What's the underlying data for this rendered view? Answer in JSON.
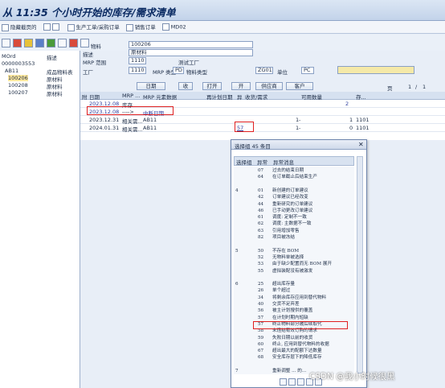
{
  "title": "从 11:35 个小时开始的库存/需求清单",
  "toolbar1": {
    "items": [
      "隐藏截页的",
      "",
      "生产工单/采购订单",
      "销售订单",
      "MD02"
    ]
  },
  "left": {
    "header": [
      "MRP",
      "描述"
    ],
    "hdr0": "MOrd",
    "rows": [
      {
        "code": "0000003553",
        "desc": ""
      },
      {
        "code": "AB11",
        "desc": "成品物料表"
      },
      {
        "code": "100206",
        "desc": "原材料"
      },
      {
        "code": "100208",
        "desc": "原材料"
      },
      {
        "code": "100207",
        "desc": "原材料"
      }
    ]
  },
  "header": {
    "material_lbl": "物料",
    "material_val": "100206",
    "desc_lbl": "描述",
    "desc_val": "原材料",
    "mrp_lbl": "MRP 范围",
    "mrp_val": "1110",
    "mrp_desc": "测试工厂",
    "plant_lbl": "工厂",
    "plant_val": "1110",
    "mrptype_lbl": "MRP 类型",
    "mrptype_val": "PD",
    "mattype_lbl": "物料类型",
    "mattype_val": "ZG01",
    "unit_lbl": "单位",
    "unit_val": "PC"
  },
  "buttons": {
    "b1": "日期",
    "b2": "收",
    "b3": "打开",
    "b4": "开",
    "b5": "供应商",
    "b6": "客户"
  },
  "page": {
    "label": "页",
    "val": "1",
    "sep": "/",
    "total": "1"
  },
  "grid": {
    "cols": [
      "附",
      "日期",
      "MRP ...",
      "MRP 元素数据",
      "再计划日期",
      "异",
      "收货/需求",
      "可用数量",
      "存..."
    ],
    "rows": [
      {
        "date": "2023.12.08",
        "mrp": "库存",
        "data": "",
        "res": "",
        "exc": "",
        "qty": "",
        "avail": "2",
        "st": ""
      },
      {
        "date": "2023.12.08",
        "mrp": "---->",
        "data": "中断日期",
        "res": "",
        "exc": "",
        "qty": "",
        "avail": "",
        "st": ""
      },
      {
        "date": "2023.12.31",
        "mrp": "相关需...",
        "data": "AB11",
        "res": "",
        "exc": "",
        "qty": "1-",
        "avail": "1",
        "st": "1101"
      },
      {
        "date": "2024.01.31",
        "mrp": "相关需...",
        "data": "AB11",
        "res": "",
        "exc": "57",
        "qty": "1-",
        "avail": "0",
        "st": "1101"
      }
    ]
  },
  "dialog": {
    "title": "选择组 45 条目",
    "col1": "选择组",
    "col2": "异常",
    "col3": "异常消息",
    "rows": [
      {
        "g": "",
        "c": "07",
        "m": "过去的结束日期"
      },
      {
        "g": "",
        "c": "64",
        "m": "在订单截止后结束生产"
      },
      {
        "g": "",
        "c": "",
        "m": ""
      },
      {
        "g": "4",
        "c": "01",
        "m": "新创建的订单建议"
      },
      {
        "g": "",
        "c": "42",
        "m": "订单建议已经改变"
      },
      {
        "g": "",
        "c": "44",
        "m": "重新研究的订单建议"
      },
      {
        "g": "",
        "c": "46",
        "m": "已手动更改订单建议"
      },
      {
        "g": "",
        "c": "61",
        "m": "调度: 定制不一致"
      },
      {
        "g": "",
        "c": "62",
        "m": "调度: 主数据不一致"
      },
      {
        "g": "",
        "c": "63",
        "m": "引用增加零售"
      },
      {
        "g": "",
        "c": "82",
        "m": "项目被冻结"
      },
      {
        "g": "",
        "c": "",
        "m": ""
      },
      {
        "g": "5",
        "c": "50",
        "m": "不存在 BOM"
      },
      {
        "g": "",
        "c": "52",
        "m": "无物料单被选择"
      },
      {
        "g": "",
        "c": "53",
        "m": "由于缺少配置而无 BOM 展开"
      },
      {
        "g": "",
        "c": "55",
        "m": "虚拟装配没有被激发"
      },
      {
        "g": "",
        "c": "",
        "m": ""
      },
      {
        "g": "6",
        "c": "25",
        "m": "超出库存量"
      },
      {
        "g": "",
        "c": "26",
        "m": "单个超过"
      },
      {
        "g": "",
        "c": "34",
        "m": "将剩余库存应用到替代物料"
      },
      {
        "g": "",
        "c": "40",
        "m": "交货不足弃差"
      },
      {
        "g": "",
        "c": "56",
        "m": "被主计划搜供的覆盖"
      },
      {
        "g": "",
        "c": "57",
        "m": "在计划时期内短缺"
      },
      {
        "g": "",
        "c": "57",
        "m": "终止物料部分被后续取代"
      },
      {
        "g": "",
        "c": "58",
        "m": "未连结有效订购的请求"
      },
      {
        "g": "",
        "c": "59",
        "m": "失败日期以前的收货"
      },
      {
        "g": "",
        "c": "60",
        "m": "终止, 应用到替代物料的收据"
      },
      {
        "g": "",
        "c": "67",
        "m": "超出最大的配额下达数量"
      },
      {
        "g": "",
        "c": "68",
        "m": "安全库存层下的降低库存"
      },
      {
        "g": "",
        "c": "",
        "m": ""
      },
      {
        "g": "7",
        "c": "",
        "m": "重新调整 ... 的..."
      }
    ]
  },
  "watermark": "CSDN @我小时候很黑"
}
